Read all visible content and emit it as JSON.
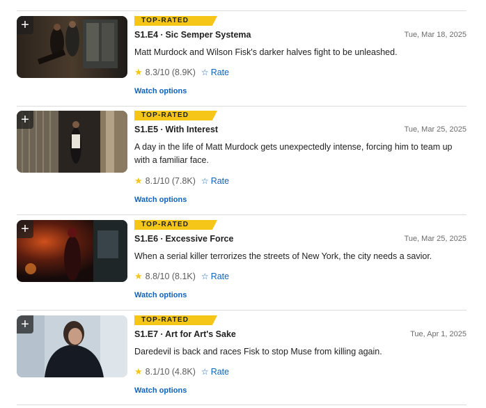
{
  "episodes": [
    {
      "badge": "TOP-RATED",
      "title": "S1.E4 ∙ Sic Semper Systema",
      "date": "Tue, Mar 18, 2025",
      "description": "Matt Murdock and Wilson Fisk's darker halves fight to be unleashed.",
      "rating": "8.3/10 (8.9K)",
      "rate_label": "Rate",
      "watch_label": "Watch options"
    },
    {
      "badge": "TOP-RATED",
      "title": "S1.E5 ∙ With Interest",
      "date": "Tue, Mar 25, 2025",
      "description": "A day in the life of Matt Murdock gets unexpectedly intense, forcing him to team up with a familiar face.",
      "rating": "8.1/10 (7.8K)",
      "rate_label": "Rate",
      "watch_label": "Watch options"
    },
    {
      "badge": "TOP-RATED",
      "title": "S1.E6 ∙ Excessive Force",
      "date": "Tue, Mar 25, 2025",
      "description": "When a serial killer terrorizes the streets of New York, the city needs a savior.",
      "rating": "8.8/10 (8.1K)",
      "rate_label": "Rate",
      "watch_label": "Watch options"
    },
    {
      "badge": "TOP-RATED",
      "title": "S1.E7 ∙ Art for Art's Sake",
      "date": "Tue, Apr 1, 2025",
      "description": "Daredevil is back and races Fisk to stop Muse from killing again.",
      "rating": "8.1/10 (4.8K)",
      "rate_label": "Rate",
      "watch_label": "Watch options"
    }
  ],
  "icons": {
    "add": "plus-icon",
    "star": "star-icon",
    "rate": "star-outline-icon"
  },
  "colors": {
    "badge": "#f5c518",
    "link": "#0e63be",
    "star": "#f5c518"
  }
}
